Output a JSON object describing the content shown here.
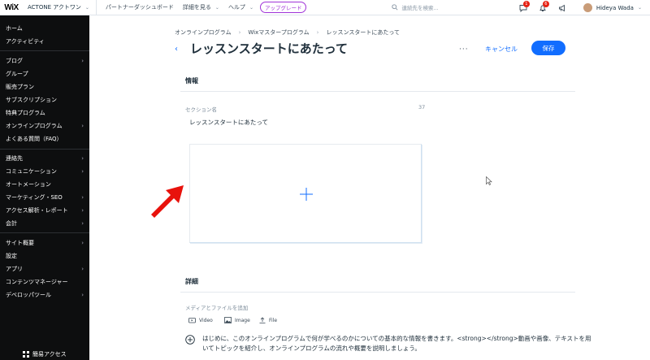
{
  "topbar": {
    "logo": "WiX",
    "site_name": "ACTONE アクトワン",
    "nav": [
      "パートナーダッシュボード",
      "詳細を見る",
      "ヘルプ"
    ],
    "upgrade": "アップグレード",
    "search_placeholder": "連続先を検索...",
    "badges": {
      "messages": "1",
      "notifications": "6"
    },
    "user_name": "Hideya Wada"
  },
  "sidebar": {
    "items": [
      {
        "label": "ホーム",
        "arrow": false
      },
      {
        "label": "アクティビティ",
        "arrow": false
      },
      {
        "label": "ブログ",
        "arrow": true
      },
      {
        "label": "グループ",
        "arrow": false
      },
      {
        "label": "販売プラン",
        "arrow": false
      },
      {
        "label": "サブスクリプション",
        "arrow": false
      },
      {
        "label": "特典プログラム",
        "arrow": false
      },
      {
        "label": "オンラインプログラム",
        "arrow": true
      },
      {
        "label": "よくある質問（FAQ）",
        "arrow": false
      },
      {
        "label": "連絡先",
        "arrow": true
      },
      {
        "label": "コミュニケーション",
        "arrow": true
      },
      {
        "label": "オートメーション",
        "arrow": false
      },
      {
        "label": "マーケティング・SEO",
        "arrow": true
      },
      {
        "label": "アクセス解析・レポート",
        "arrow": true
      },
      {
        "label": "会計",
        "arrow": true
      },
      {
        "label": "サイト概要",
        "arrow": true
      },
      {
        "label": "設定",
        "arrow": false
      },
      {
        "label": "アプリ",
        "arrow": true
      },
      {
        "label": "コンテンツマネージャー",
        "arrow": false
      },
      {
        "label": "デベロッパツール",
        "arrow": true
      }
    ],
    "quick_access": "簡易アクセス"
  },
  "main": {
    "breadcrumb": [
      "オンラインプログラム",
      "Wixマスタープログラム",
      "レッスンスタートにあたって"
    ],
    "title": "レッスンスタートにあたって",
    "more": "···",
    "cancel": "キャンセル",
    "save": "保存",
    "info_header": "情報",
    "field_label": "セクション名",
    "char_count": "37",
    "field_value": "レッスンスタートにあたって",
    "details_header": "詳細",
    "media_label": "メディアとファイルを追加",
    "media_buttons": [
      "Video",
      "Image",
      "File"
    ],
    "description": "はじめに、このオンラインプログラムで何が学べるのかについての基本的な情報を書きます。<strong></strong>動画や画像、テキストを用いてトピックを紹介し、オンラインプログラムの流れや概要を説明しましょう。"
  },
  "colors": {
    "accent": "#116dff",
    "sidebar_bg": "#0d0e0f",
    "arrow": "#e8120c",
    "upgrade": "#a033d8"
  }
}
